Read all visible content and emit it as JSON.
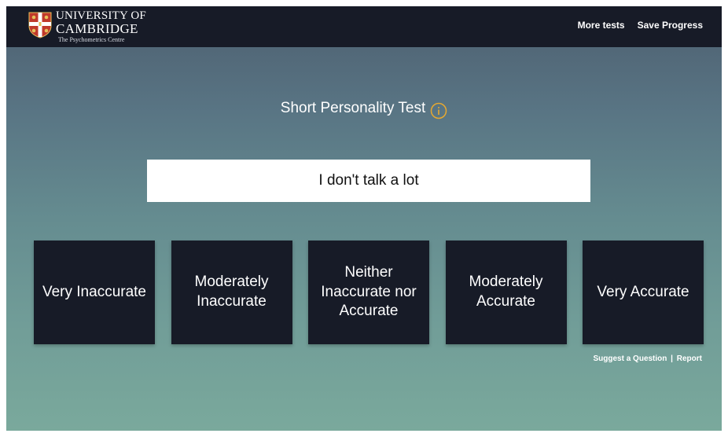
{
  "header": {
    "logo": {
      "line1": "UNIVERSITY OF",
      "line2": "CAMBRIDGE",
      "line3": "The Psychometrics Centre"
    },
    "nav": {
      "more_tests": "More tests",
      "save_progress": "Save Progress"
    }
  },
  "main": {
    "title": "Short Personality Test",
    "question": "I don't talk a lot",
    "answers": [
      {
        "label": "Very Inaccurate"
      },
      {
        "label": "Moderately Inaccurate"
      },
      {
        "label": "Neither Inaccurate nor Accurate"
      },
      {
        "label": "Moderately Accurate"
      },
      {
        "label": "Very Accurate"
      }
    ]
  },
  "footer": {
    "suggest_question": "Suggest a Question",
    "separator": "|",
    "report": "Report"
  },
  "colors": {
    "header_bg": "#171b27",
    "answer_bg": "#171b27",
    "info_icon": "#e8a930",
    "gradient_top": "#4d5f70",
    "gradient_bottom": "#7aa99c"
  },
  "icons": {
    "logo": "university-shield-icon",
    "info": "info-icon"
  }
}
